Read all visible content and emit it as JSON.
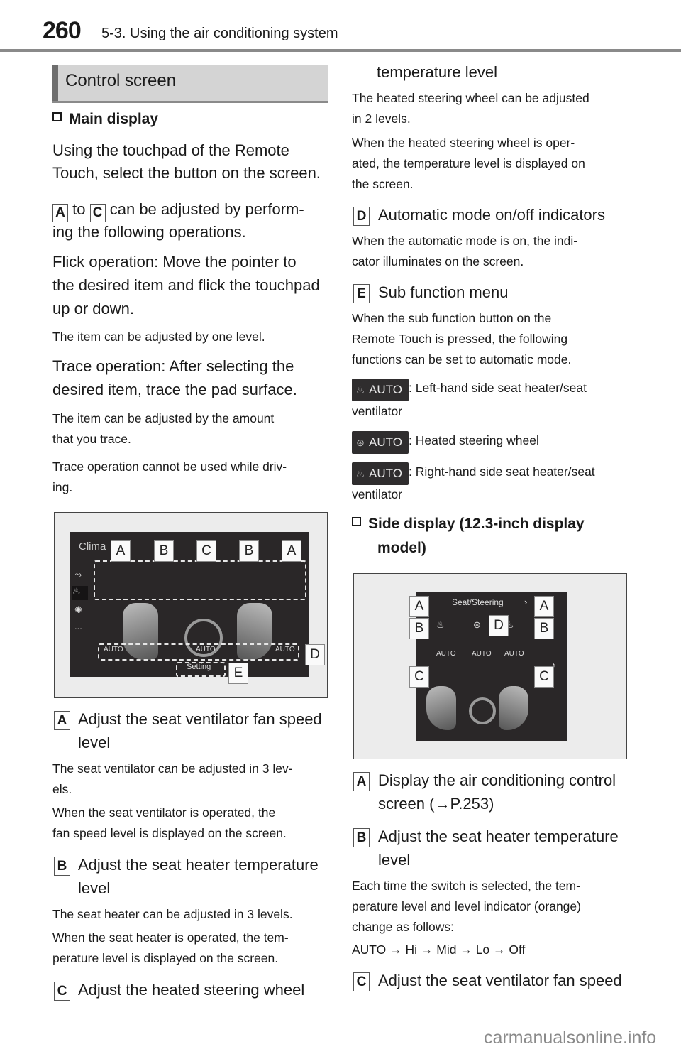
{
  "header": {
    "page_number": "260",
    "chapter": "5-3. Using the air conditioning system"
  },
  "section_title": "Control screen",
  "left": {
    "main_display_heading": "Main display",
    "intro": [
      "Using the touchpad of the Remote",
      "Touch, select the button on the screen."
    ],
    "range_key_from": "A",
    "range_to": "to",
    "range_key_to": "C",
    "range_rest": "can be adjusted by perform-",
    "range_line2": "ing the following operations.",
    "flick": [
      "Flick operation: Move the pointer to",
      "the desired item and flick the touchpad",
      "up or down."
    ],
    "flick_note": "The item can be adjusted by one level.",
    "trace": [
      "Trace operation: After selecting the",
      "desired item, trace the pad surface."
    ],
    "trace_note": [
      "The item can be adjusted by the amount",
      "that you trace."
    ],
    "trace_warning": [
      "Trace operation cannot be used while driv-",
      "ing."
    ],
    "figure1": {
      "title": "Clima",
      "labels": [
        "A",
        "B",
        "C",
        "B",
        "A",
        "D",
        "E"
      ],
      "auto": "AUTO",
      "setting": "Setting",
      "more": "..."
    },
    "item_a": {
      "key": "A",
      "title": [
        "Adjust the seat ventilator fan speed",
        "level"
      ],
      "notes": [
        "The seat ventilator can be adjusted in 3 lev-",
        "els.",
        "When the seat ventilator is operated, the",
        "fan speed level is displayed on the screen."
      ]
    },
    "item_b": {
      "key": "B",
      "title": [
        "Adjust the seat heater temperature",
        "level"
      ],
      "notes": [
        "The seat heater can be adjusted in 3 levels.",
        "When the seat heater is operated, the tem-",
        "perature level is displayed on the screen."
      ]
    },
    "item_c": {
      "key": "C",
      "title": "Adjust the heated steering wheel"
    }
  },
  "right": {
    "c_cont": "temperature level",
    "c_notes": [
      "The heated steering wheel can be adjusted",
      "in 2 levels.",
      "When the heated steering wheel is oper-",
      "ated, the temperature level is displayed on",
      "the screen."
    ],
    "item_d": {
      "key": "D",
      "title": "Automatic mode on/off indicators",
      "notes": [
        "When the automatic mode is on, the indi-",
        "cator illuminates on the screen."
      ]
    },
    "item_e": {
      "key": "E",
      "title": "Sub function menu",
      "notes": [
        "When the sub function button on the",
        "Remote Touch is pressed, the following",
        "functions can be set to automatic mode."
      ]
    },
    "auto_label": "AUTO",
    "auto_items": [
      {
        "icon": "left-seat-icon",
        "text": ": Left-hand side seat heater/seat",
        "text2": "ventilator"
      },
      {
        "icon": "heated-steering-icon",
        "text": ": Heated steering wheel"
      },
      {
        "icon": "right-seat-icon",
        "text": ": Right-hand side seat heater/seat",
        "text2": "ventilator"
      }
    ],
    "side_heading": [
      "Side display (12.3-inch display",
      "model)"
    ],
    "figure2": {
      "title": "Seat/Steering",
      "auto": "AUTO",
      "labels": [
        "A",
        "A",
        "B",
        "D",
        "B",
        "C",
        "C"
      ]
    },
    "item_a": {
      "key": "A",
      "title": [
        "Display the air conditioning control",
        "screen (→P.253)"
      ]
    },
    "item_b": {
      "key": "B",
      "title": [
        "Adjust the seat heater temperature",
        "level"
      ],
      "notes": [
        "Each time the switch is selected, the tem-",
        "perature level and level indicator (orange)",
        "change as follows:"
      ],
      "sequence": "AUTO → Hi → Mid → Lo → Off"
    },
    "item_c": {
      "key": "C",
      "title": "Adjust the seat ventilator fan speed"
    }
  },
  "watermark": "carmanualsonline.info"
}
